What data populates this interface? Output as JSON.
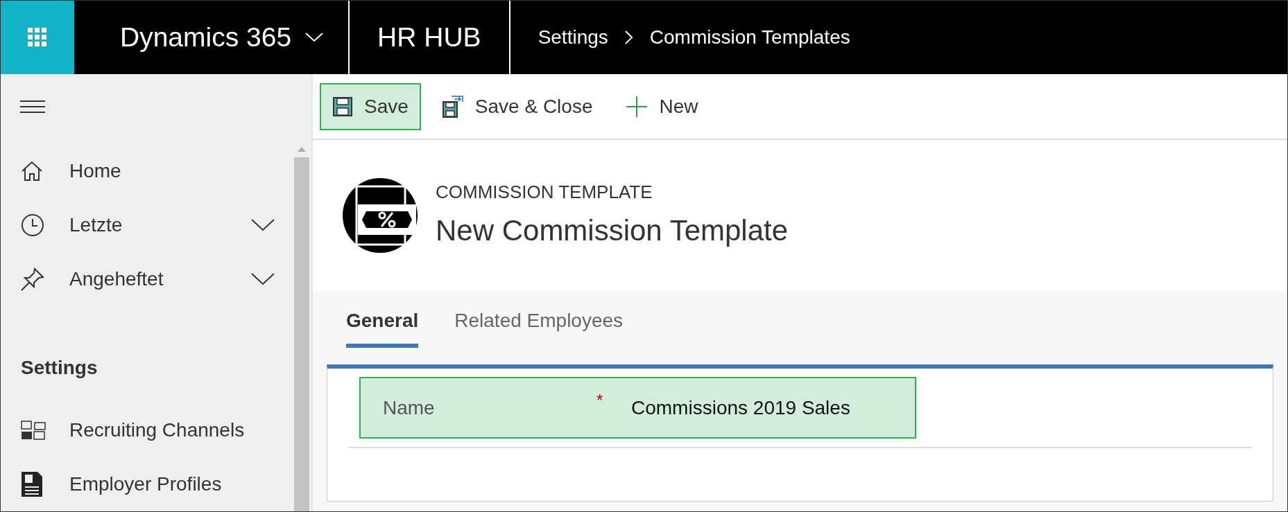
{
  "top_bar": {
    "app_name": "Dynamics 365",
    "area": "HR HUB",
    "breadcrumb": [
      "Settings",
      "Commission Templates"
    ]
  },
  "sidebar": {
    "items": [
      {
        "label": "Home",
        "expandable": false
      },
      {
        "label": "Letzte",
        "expandable": true
      },
      {
        "label": "Angeheftet",
        "expandable": true
      }
    ],
    "section_title": "Settings",
    "section_items": [
      {
        "label": "Recruiting Channels"
      },
      {
        "label": "Employer Profiles"
      }
    ]
  },
  "toolbar": [
    {
      "label": "Save",
      "highlighted": true
    },
    {
      "label": "Save & Close",
      "highlighted": false
    },
    {
      "label": "New",
      "highlighted": false
    }
  ],
  "header": {
    "entity": "COMMISSION TEMPLATE",
    "title": "New Commission Template"
  },
  "tabs": [
    {
      "label": "General",
      "selected": true
    },
    {
      "label": "Related Employees",
      "selected": false
    }
  ],
  "form": {
    "fields": [
      {
        "label": "Name",
        "required_mark": "*",
        "value": "Commissions 2019 Sales",
        "highlighted": true
      }
    ]
  }
}
